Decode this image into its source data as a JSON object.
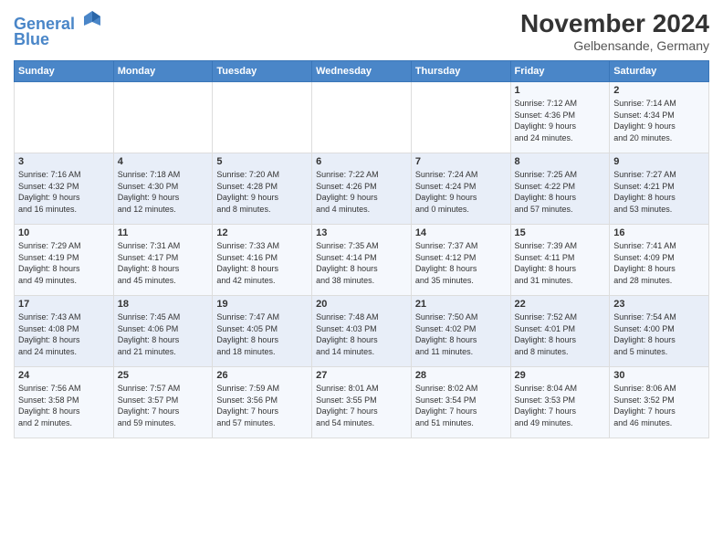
{
  "header": {
    "logo_line1": "General",
    "logo_line2": "Blue",
    "month_title": "November 2024",
    "location": "Gelbensande, Germany"
  },
  "weekdays": [
    "Sunday",
    "Monday",
    "Tuesday",
    "Wednesday",
    "Thursday",
    "Friday",
    "Saturday"
  ],
  "weeks": [
    [
      {
        "day": "",
        "info": ""
      },
      {
        "day": "",
        "info": ""
      },
      {
        "day": "",
        "info": ""
      },
      {
        "day": "",
        "info": ""
      },
      {
        "day": "",
        "info": ""
      },
      {
        "day": "1",
        "info": "Sunrise: 7:12 AM\nSunset: 4:36 PM\nDaylight: 9 hours\nand 24 minutes."
      },
      {
        "day": "2",
        "info": "Sunrise: 7:14 AM\nSunset: 4:34 PM\nDaylight: 9 hours\nand 20 minutes."
      }
    ],
    [
      {
        "day": "3",
        "info": "Sunrise: 7:16 AM\nSunset: 4:32 PM\nDaylight: 9 hours\nand 16 minutes."
      },
      {
        "day": "4",
        "info": "Sunrise: 7:18 AM\nSunset: 4:30 PM\nDaylight: 9 hours\nand 12 minutes."
      },
      {
        "day": "5",
        "info": "Sunrise: 7:20 AM\nSunset: 4:28 PM\nDaylight: 9 hours\nand 8 minutes."
      },
      {
        "day": "6",
        "info": "Sunrise: 7:22 AM\nSunset: 4:26 PM\nDaylight: 9 hours\nand 4 minutes."
      },
      {
        "day": "7",
        "info": "Sunrise: 7:24 AM\nSunset: 4:24 PM\nDaylight: 9 hours\nand 0 minutes."
      },
      {
        "day": "8",
        "info": "Sunrise: 7:25 AM\nSunset: 4:22 PM\nDaylight: 8 hours\nand 57 minutes."
      },
      {
        "day": "9",
        "info": "Sunrise: 7:27 AM\nSunset: 4:21 PM\nDaylight: 8 hours\nand 53 minutes."
      }
    ],
    [
      {
        "day": "10",
        "info": "Sunrise: 7:29 AM\nSunset: 4:19 PM\nDaylight: 8 hours\nand 49 minutes."
      },
      {
        "day": "11",
        "info": "Sunrise: 7:31 AM\nSunset: 4:17 PM\nDaylight: 8 hours\nand 45 minutes."
      },
      {
        "day": "12",
        "info": "Sunrise: 7:33 AM\nSunset: 4:16 PM\nDaylight: 8 hours\nand 42 minutes."
      },
      {
        "day": "13",
        "info": "Sunrise: 7:35 AM\nSunset: 4:14 PM\nDaylight: 8 hours\nand 38 minutes."
      },
      {
        "day": "14",
        "info": "Sunrise: 7:37 AM\nSunset: 4:12 PM\nDaylight: 8 hours\nand 35 minutes."
      },
      {
        "day": "15",
        "info": "Sunrise: 7:39 AM\nSunset: 4:11 PM\nDaylight: 8 hours\nand 31 minutes."
      },
      {
        "day": "16",
        "info": "Sunrise: 7:41 AM\nSunset: 4:09 PM\nDaylight: 8 hours\nand 28 minutes."
      }
    ],
    [
      {
        "day": "17",
        "info": "Sunrise: 7:43 AM\nSunset: 4:08 PM\nDaylight: 8 hours\nand 24 minutes."
      },
      {
        "day": "18",
        "info": "Sunrise: 7:45 AM\nSunset: 4:06 PM\nDaylight: 8 hours\nand 21 minutes."
      },
      {
        "day": "19",
        "info": "Sunrise: 7:47 AM\nSunset: 4:05 PM\nDaylight: 8 hours\nand 18 minutes."
      },
      {
        "day": "20",
        "info": "Sunrise: 7:48 AM\nSunset: 4:03 PM\nDaylight: 8 hours\nand 14 minutes."
      },
      {
        "day": "21",
        "info": "Sunrise: 7:50 AM\nSunset: 4:02 PM\nDaylight: 8 hours\nand 11 minutes."
      },
      {
        "day": "22",
        "info": "Sunrise: 7:52 AM\nSunset: 4:01 PM\nDaylight: 8 hours\nand 8 minutes."
      },
      {
        "day": "23",
        "info": "Sunrise: 7:54 AM\nSunset: 4:00 PM\nDaylight: 8 hours\nand 5 minutes."
      }
    ],
    [
      {
        "day": "24",
        "info": "Sunrise: 7:56 AM\nSunset: 3:58 PM\nDaylight: 8 hours\nand 2 minutes."
      },
      {
        "day": "25",
        "info": "Sunrise: 7:57 AM\nSunset: 3:57 PM\nDaylight: 7 hours\nand 59 minutes."
      },
      {
        "day": "26",
        "info": "Sunrise: 7:59 AM\nSunset: 3:56 PM\nDaylight: 7 hours\nand 57 minutes."
      },
      {
        "day": "27",
        "info": "Sunrise: 8:01 AM\nSunset: 3:55 PM\nDaylight: 7 hours\nand 54 minutes."
      },
      {
        "day": "28",
        "info": "Sunrise: 8:02 AM\nSunset: 3:54 PM\nDaylight: 7 hours\nand 51 minutes."
      },
      {
        "day": "29",
        "info": "Sunrise: 8:04 AM\nSunset: 3:53 PM\nDaylight: 7 hours\nand 49 minutes."
      },
      {
        "day": "30",
        "info": "Sunrise: 8:06 AM\nSunset: 3:52 PM\nDaylight: 7 hours\nand 46 minutes."
      }
    ]
  ]
}
